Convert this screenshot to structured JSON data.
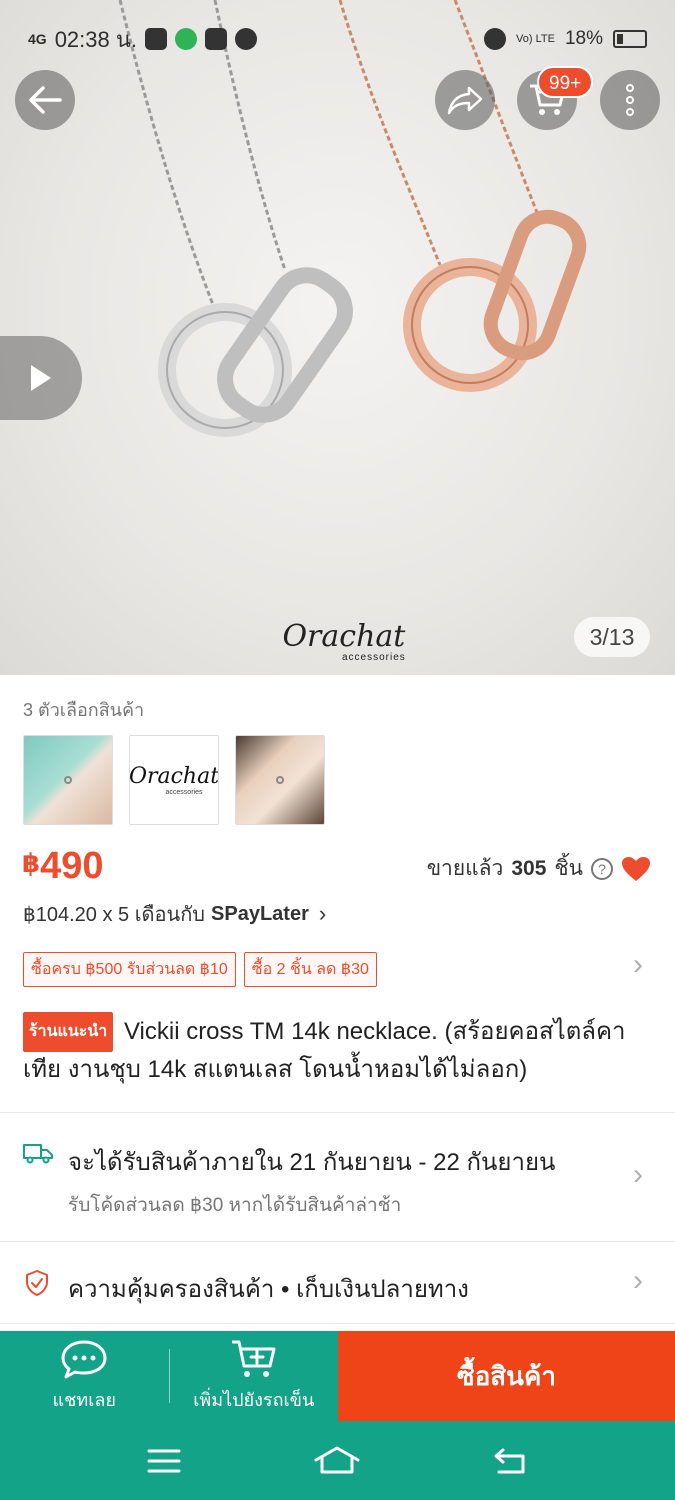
{
  "status_bar": {
    "network": "4G",
    "time": "02:38 น.",
    "volte": "Vo) LTE",
    "battery": "18%"
  },
  "hero": {
    "image_counter": "3/13",
    "watermark_brand": "Orachat",
    "watermark_sub": "accessories",
    "cart_badge": "99+"
  },
  "product": {
    "variants_label": "3 ตัวเลือกสินค้า",
    "variant_logo": "Orachat",
    "variant_logo_sub": "accessories",
    "price_currency": "฿",
    "price_amount": "490",
    "sold_label": "ขายแล้ว",
    "sold_count": "305",
    "sold_unit": "ชิ้น",
    "installment_text": "฿104.20 x 5 เดือนกับ",
    "installment_brand": "SPayLater",
    "promos": [
      "ซื้อครบ ฿500 รับส่วนลด ฿10",
      "ซื้อ 2 ชิ้น ลด ฿30"
    ],
    "recommended_tag": "ร้านแนะนำ",
    "title": "Vickii cross TM 14k necklace. (สร้อยคอสไตล์คาเทีย งานชุบ 14k สแตนเลส โดนน้ำหอมได้ไม่ลอก)"
  },
  "shipping": {
    "eta": "จะได้รับสินค้าภายใน 21 กันยายน - 22 กันยายน",
    "late_voucher": "รับโค้ดส่วนลด ฿30 หากได้รับสินค้าล่าช้า"
  },
  "guarantee": {
    "text": "ความคุ้มครองสินค้า • เก็บเงินปลายทาง"
  },
  "bottom_bar": {
    "chat_label": "แชทเลย",
    "add_cart_label": "เพิ่มไปยังรถเข็น",
    "buy_label": "ซื้อสินค้า"
  },
  "colors": {
    "accent": "#ee4d2d",
    "buy_button": "#ee4418",
    "bottom_bar": "#13a388"
  }
}
